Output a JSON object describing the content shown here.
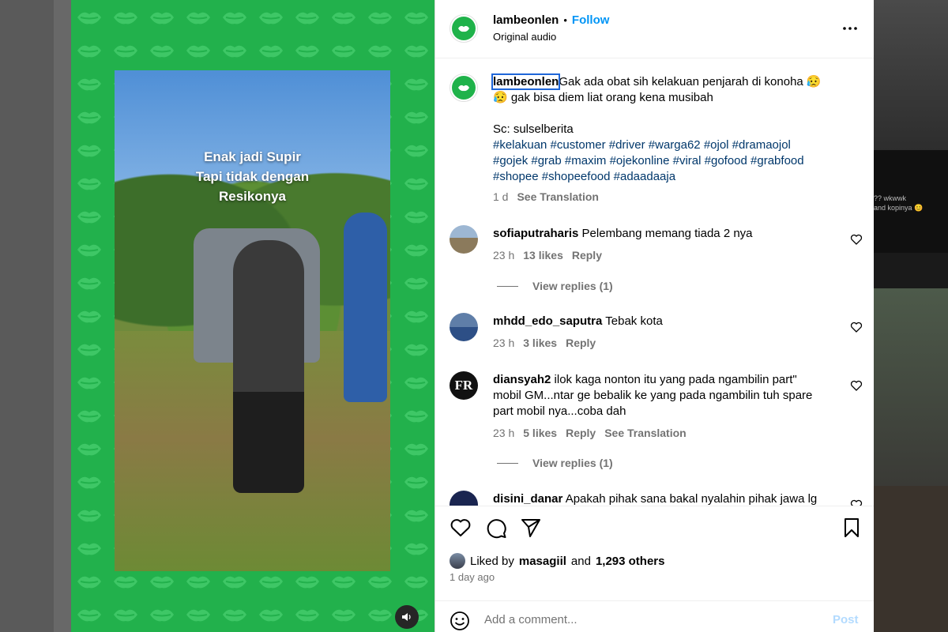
{
  "media": {
    "overlay_lines": [
      "Enak jadi Supir",
      "Tapi tidak dengan",
      "Resikonya"
    ],
    "background_color": "#22b14c",
    "mute_icon": "speaker-icon"
  },
  "header": {
    "username": "lambeonlen",
    "separator": "•",
    "follow_label": "Follow",
    "audio": "Original audio",
    "more_icon": "more-horizontal-icon"
  },
  "caption": {
    "username": "lambeonlen",
    "line1": "Gak ada obat sih kelakuan penjarah di konoha 😥",
    "line2": "😥 gak bisa diem liat orang kena musibah",
    "source": "Sc: sulselberita",
    "hashtags_line1": "#kelakuan #customer #driver #warga62 #ojol #dramaojol",
    "hashtags_line2": "#gojek #grab #maxim #ojekonline #viral #gofood #grabfood",
    "hashtags_line3": "#shopee #shopeefood #adaadaaja",
    "time": "1 d",
    "see_translation": "See Translation"
  },
  "comments": [
    {
      "username": "sofiaputraharis",
      "text": "Pelembang memang tiada 2 nya",
      "time": "23 h",
      "likes": "13 likes",
      "reply": "Reply",
      "view_replies": "View replies (1)"
    },
    {
      "username": "mhdd_edo_saputra",
      "text": "Tebak kota",
      "time": "23 h",
      "likes": "3 likes",
      "reply": "Reply"
    },
    {
      "username": "diansyah2",
      "text_line1": "ilok kaga nonton itu yang pada ngambilin part\"",
      "text_line2": "mobil GM...ntar ge bebalik ke yang pada ngambilin tuh spare",
      "text_line3": "part mobil nya...coba dah",
      "avatar_text": "FR",
      "time": "23 h",
      "likes": "5 likes",
      "reply": "Reply",
      "see_translation": "See Translation",
      "view_replies": "View replies (1)"
    },
    {
      "username": "disini_danar",
      "text": "Apakah pihak sana bakal nyalahin pihak jawa lg"
    }
  ],
  "actions": {
    "like_icon": "heart-icon",
    "comment_icon": "comment-icon",
    "share_icon": "send-icon",
    "save_icon": "bookmark-icon"
  },
  "likes": {
    "prefix": "Liked by",
    "user": "masagiil",
    "middle": "and",
    "others": "1,293 others"
  },
  "posted": "1 day ago",
  "add_comment": {
    "emoji_icon": "emoji-icon",
    "placeholder": "Add a comment...",
    "post_label": "Post"
  },
  "background_right": {
    "snippet_line1": "?? wkwwk",
    "snippet_line2": "and kopinya 😊"
  }
}
